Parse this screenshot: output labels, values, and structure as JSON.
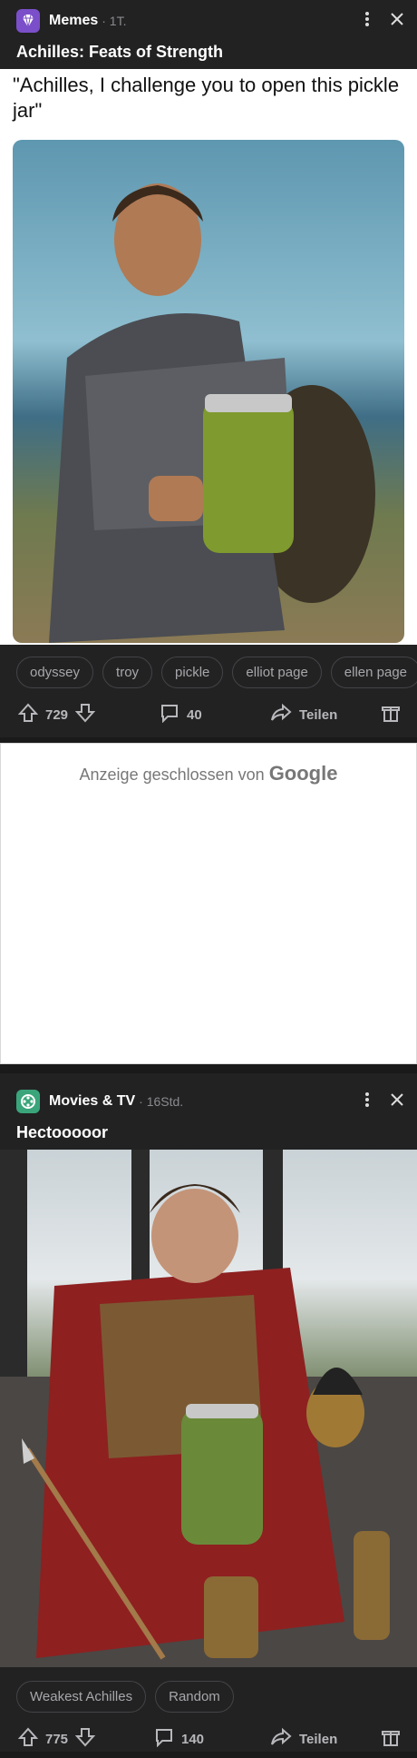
{
  "post1": {
    "subreddit": "Memes",
    "time": "· 1T.",
    "title": "Achilles: Feats of Strength",
    "meme_text": "\"Achilles, I challenge you to open this pickle jar\"",
    "image_alt": "Man in armor holding a pickle jar",
    "tags": [
      "odyssey",
      "troy",
      "pickle",
      "elliot page",
      "ellen page"
    ],
    "votes": "729",
    "comments": "40",
    "share": "Teilen"
  },
  "ad": {
    "label": "Anzeige geschlossen von",
    "brand": "Google"
  },
  "post2": {
    "subreddit": "Movies & TV",
    "time": "· 16Std.",
    "title": "Hectooooor",
    "image_alt": "Person in armor opening a pickle jar",
    "tags": [
      "Weakest Achilles",
      "Random"
    ],
    "votes": "775",
    "comments": "140",
    "share": "Teilen"
  },
  "colors": {
    "background": "#1a1a1b",
    "card": "#222223",
    "memes_icon": "#7b4fc9",
    "movies_icon": "#3aa57a"
  }
}
